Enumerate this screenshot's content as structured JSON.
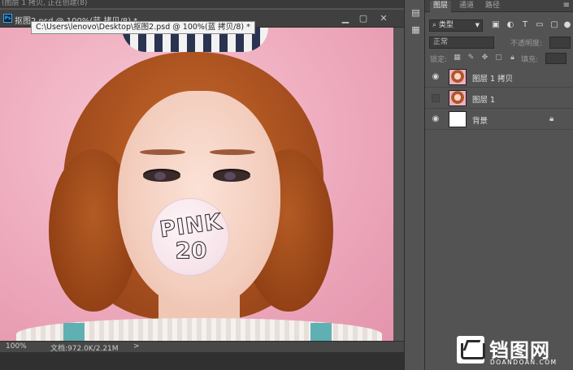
{
  "window": {
    "top_strip_text": "(图层 1 拷贝, 正在创建(8)",
    "doc_tab": "抠图2.psd @ 100%(蓝 拷贝/8) *",
    "tooltip": "C:\\Users\\lenovo\\Desktop\\抠图2.psd @ 100%(蓝 拷贝/8) *",
    "minimize_icon": "minimize-icon",
    "maximize_icon": "maximize-icon",
    "close_icon": "close-icon"
  },
  "canvas": {
    "bubble_line1": "PINK",
    "bubble_line2": "20"
  },
  "status": {
    "zoom": "100%",
    "doc_info": "文档:972.0K/2.21M",
    "arrow": ">"
  },
  "panel": {
    "tabs": [
      {
        "label": "图层",
        "active": true
      },
      {
        "label": "通道",
        "active": false
      },
      {
        "label": "路径",
        "active": false
      }
    ],
    "menu_icon": "≡",
    "filter_kind": "类型",
    "blend_mode": "正常",
    "opacity_label": "不透明度:",
    "lock_label": "锁定:",
    "fill_label": "填充:",
    "layers": [
      {
        "name": "图层 1 拷贝",
        "visible": true,
        "thumb": "photo",
        "locked": false
      },
      {
        "name": "图层 1",
        "visible": false,
        "thumb": "photo",
        "locked": false
      },
      {
        "name": "背景",
        "visible": true,
        "thumb": "white",
        "locked": true
      }
    ]
  },
  "watermark": {
    "title": "铛图网",
    "subtitle": "DOANDOAN.COM"
  },
  "colors": {
    "panel_bg": "#535353",
    "canvas_pink": "#f0b3c3",
    "ps_blue": "#31a8ff"
  }
}
